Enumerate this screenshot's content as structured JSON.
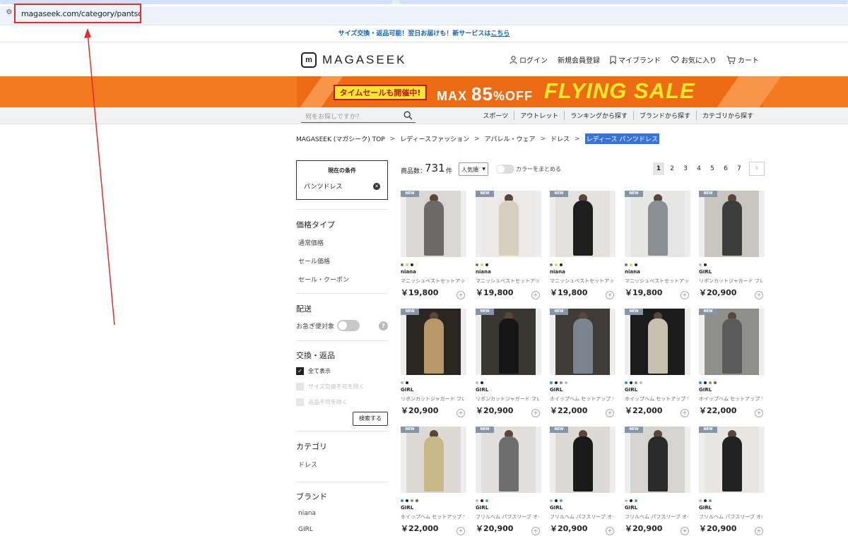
{
  "browser": {
    "url": "magaseek.com/category/pantsdress_l",
    "site_icon": "tune-icon"
  },
  "notice": {
    "text": "サイズ交換・返品可能！翌日お届けも！新サービスは",
    "link": "こちら"
  },
  "header": {
    "logo_mark": "m",
    "logo_text": "MAGASEEK",
    "nav": [
      {
        "label": "ログイン",
        "icon": "user-icon"
      },
      {
        "label": "新規会員登録",
        "icon": ""
      },
      {
        "label": "マイブランド",
        "icon": "bookmark-icon"
      },
      {
        "label": "お気に入り",
        "icon": "heart-icon"
      },
      {
        "label": "カート",
        "icon": "cart-icon"
      }
    ]
  },
  "banner": {
    "pill": "タイムセールも開催中!",
    "max_prefix": "MAX",
    "max_number": "85",
    "max_suffix": "%OFF",
    "flying": "FLYING SALE"
  },
  "subnav": {
    "search_placeholder": "何をお探しですか？",
    "links": [
      "スポーツ",
      "アウトレット",
      "ランキングから探す",
      "ブランドから探す",
      "カテゴリから探す"
    ]
  },
  "breadcrumb": [
    "MAGASEEK (マガシーク) TOP",
    "レディースファッション",
    "アパレル・ウェア",
    "ドレス",
    "レディース パンツドレス"
  ],
  "filters": {
    "current_title": "現在の条件",
    "current_value": "パンツドレス",
    "price_type_title": "価格タイプ",
    "price_types": [
      "通常価格",
      "セール価格",
      "セール・クーポン"
    ],
    "delivery_title": "配送",
    "delivery_item": "お急ぎ便対象",
    "exchange_title": "交換・返品",
    "exchange_options": [
      {
        "label": "全て表示",
        "checked": true
      },
      {
        "label": "サイズ交換不可を除く",
        "checked": false
      },
      {
        "label": "返品不可を除く",
        "checked": false
      }
    ],
    "search_button": "検索する",
    "category_title": "カテゴリ",
    "category_items": [
      "ドレス"
    ],
    "brand_title": "ブランド",
    "brand_items": [
      "niana",
      "GIRL"
    ]
  },
  "toolbar": {
    "count_label": "商品数：",
    "count": "731",
    "count_unit": "件",
    "sort": "人気順",
    "color_toggle_label": "カラーをまとめる",
    "pages": [
      "1",
      "2",
      "3",
      "4",
      "5",
      "6",
      "7"
    ],
    "next": "›"
  },
  "products": [
    {
      "badge": "NEW",
      "brand": "niana",
      "name": "マニッシュベストセットアップ",
      "price": "￥19,800",
      "colors": [
        "#777777",
        "#e8d35a",
        "#222222"
      ],
      "tone": "#6c6a66",
      "bg": "#d9d7d4"
    },
    {
      "badge": "NEW",
      "brand": "niana",
      "name": "マニッシュベストセットアップ",
      "price": "￥19,800",
      "colors": [
        "#777777",
        "#e8d35a",
        "#222222"
      ],
      "tone": "#d8cfbf",
      "bg": "#eceae6"
    },
    {
      "badge": "NEW",
      "brand": "niana",
      "name": "マニッシュベストセットアップ",
      "price": "￥19,800",
      "colors": [
        "#777777",
        "#e8d35a",
        "#222222"
      ],
      "tone": "#1e1e1e",
      "bg": "#e3e2df"
    },
    {
      "badge": "NEW",
      "brand": "niana",
      "name": "マニッシュベストセットアップ",
      "price": "￥19,800",
      "colors": [
        "#777777",
        "#e8d35a",
        "#222222"
      ],
      "tone": "#8a8f96",
      "bg": "#e6e6e4"
    },
    {
      "badge": "NEW",
      "brand": "GIRL",
      "name": "リボンカットジャガード フレア",
      "price": "￥20,900",
      "colors": [
        "#bbbbbb",
        "#222222"
      ],
      "tone": "#3c3c3c",
      "bg": "#c9c6c0"
    },
    {
      "badge": "NEW",
      "brand": "GIRL",
      "name": "リボンカットジャガード フレア",
      "price": "￥20,900",
      "colors": [
        "#bbbbbb",
        "#222222"
      ],
      "tone": "#b89868",
      "bg": "#2a2622"
    },
    {
      "badge": "NEW",
      "brand": "GIRL",
      "name": "リボンカットジャガード フレア",
      "price": "￥20,900",
      "colors": [
        "#bbbbbb",
        "#222222"
      ],
      "tone": "#151515",
      "bg": "#3a3631"
    },
    {
      "badge": "NEW",
      "brand": "GIRL",
      "name": "ホイップヘム セットアップ ワイド",
      "price": "￥22,000",
      "colors": [
        "#3b8fd8",
        "#222222",
        "#7a9a7a",
        "#bbbbbb"
      ],
      "tone": "#7a8590",
      "bg": "#3e3b38"
    },
    {
      "badge": "NEW",
      "brand": "GIRL",
      "name": "ホイップヘム セットアップ ワイド",
      "price": "￥22,000",
      "colors": [
        "#3b8fd8",
        "#222222",
        "#7a9a7a",
        "#bbbbbb"
      ],
      "tone": "#c8c0b0",
      "bg": "#1b1b1b"
    },
    {
      "badge": "NEW",
      "brand": "GIRL",
      "name": "ホイップヘム セットアップ ワイド",
      "price": "￥22,000",
      "colors": [
        "#3b8fd8",
        "#222222",
        "#7a9a7a",
        "#8a5a3a"
      ],
      "tone": "#5a5a5a",
      "bg": "#8f8f8c"
    },
    {
      "badge": "NEW",
      "brand": "GIRL",
      "name": "ホイップヘム セットアップ ワイド",
      "price": "￥22,000",
      "colors": [
        "#3b8fd8",
        "#222222",
        "#7a9a7a",
        "#8a5a3a"
      ],
      "tone": "#c8b888",
      "bg": "#dddad5"
    },
    {
      "badge": "NEW",
      "brand": "GIRL",
      "name": "フリルヘム パフスリーブ オール",
      "price": "￥20,900",
      "colors": [
        "#bbbbbb",
        "#222222",
        "#6aa86a"
      ],
      "tone": "#6e6e6e",
      "bg": "#e0dfdc"
    },
    {
      "badge": "NEW",
      "brand": "GIRL",
      "name": "フリルヘム パフスリーブ オール",
      "price": "￥20,900",
      "colors": [
        "#bbbbbb",
        "#222222",
        "#6aa86a"
      ],
      "tone": "#1a1a1a",
      "bg": "#dcdad6"
    },
    {
      "badge": "NEW",
      "brand": "GIRL",
      "name": "フリルヘム パフスリーブ オール",
      "price": "￥20,900",
      "colors": [
        "#bbbbbb",
        "#222222",
        "#6aa86a"
      ],
      "tone": "#2a2a2a",
      "bg": "#d6d4d0"
    },
    {
      "badge": "NEW",
      "brand": "GIRL",
      "name": "フリルヘム パフスリーブ オール",
      "price": "￥20,900",
      "colors": [
        "#bbbbbb",
        "#222222",
        "#6aa86a"
      ],
      "tone": "#222222",
      "bg": "#e7e6e3"
    }
  ],
  "colors": {
    "accent_orange": "#f47a21",
    "highlight_red": "#e52a2a",
    "notice_blue": "#0f63b5",
    "selection_blue": "#3874d8"
  }
}
